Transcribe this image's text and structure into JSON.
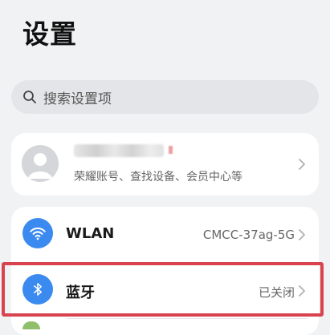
{
  "page": {
    "title": "设置"
  },
  "search": {
    "placeholder": "搜索设置项",
    "icon": "search-icon"
  },
  "account": {
    "subtitle": "荣耀账号、查找设备、会员中心等",
    "avatar_icon": "user-avatar-icon"
  },
  "list": {
    "items": [
      {
        "label": "WLAN",
        "value": "CMCC-37ag-5G",
        "icon": "wifi-icon",
        "icon_color": "#3b8af0"
      },
      {
        "label": "蓝牙",
        "value": "已关闭",
        "icon": "bluetooth-icon",
        "icon_color": "#3b8af0"
      }
    ]
  },
  "colors": {
    "background": "#f1f2f4",
    "card": "#ffffff",
    "accent": "#3b8af0",
    "highlight": "#d9434f"
  }
}
